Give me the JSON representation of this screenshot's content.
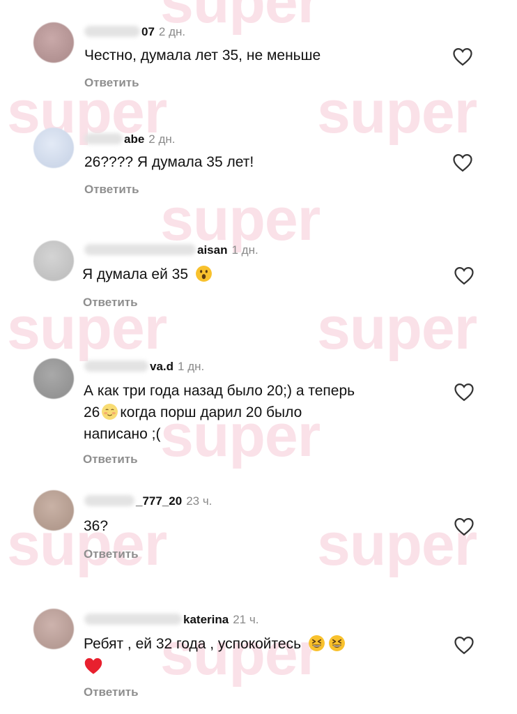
{
  "watermark": "super",
  "comments": [
    {
      "username": "07",
      "age": "2 дн.",
      "text": "Честно, думала лет 35, не меньше",
      "reply": "Ответить"
    },
    {
      "username": "abe",
      "age": "2 дн.",
      "text": "26???? Я думала 35 лет!",
      "reply": "Ответить"
    },
    {
      "username": "aisan",
      "age": "1 дн.",
      "text": "Я думала ей 35",
      "reply": "Ответить",
      "emoji": "astonished-face-icon"
    },
    {
      "username": "va.d",
      "age": "1 дн.",
      "text_parts": [
        "А как три года назад было 20;) а теперь",
        "26",
        "когда порш дарил 20 было",
        "написано ;("
      ],
      "emoji": "blushing-face-icon",
      "reply": "Ответить"
    },
    {
      "username": "_777_20",
      "age": "23 ч.",
      "text": "36?",
      "reply": "Ответить"
    },
    {
      "username": "katerina",
      "age": "21 ч.",
      "text": "Ребят , ей 32 года , успокойтесь",
      "emojis": [
        "grinning-squinting-face-icon",
        "grinning-squinting-face-icon",
        "red-heart-icon"
      ],
      "reply": "Ответить"
    }
  ],
  "colors": {
    "watermark": "#f7c9d6",
    "secondary_text": "#8e8e8e",
    "text": "#111111"
  }
}
